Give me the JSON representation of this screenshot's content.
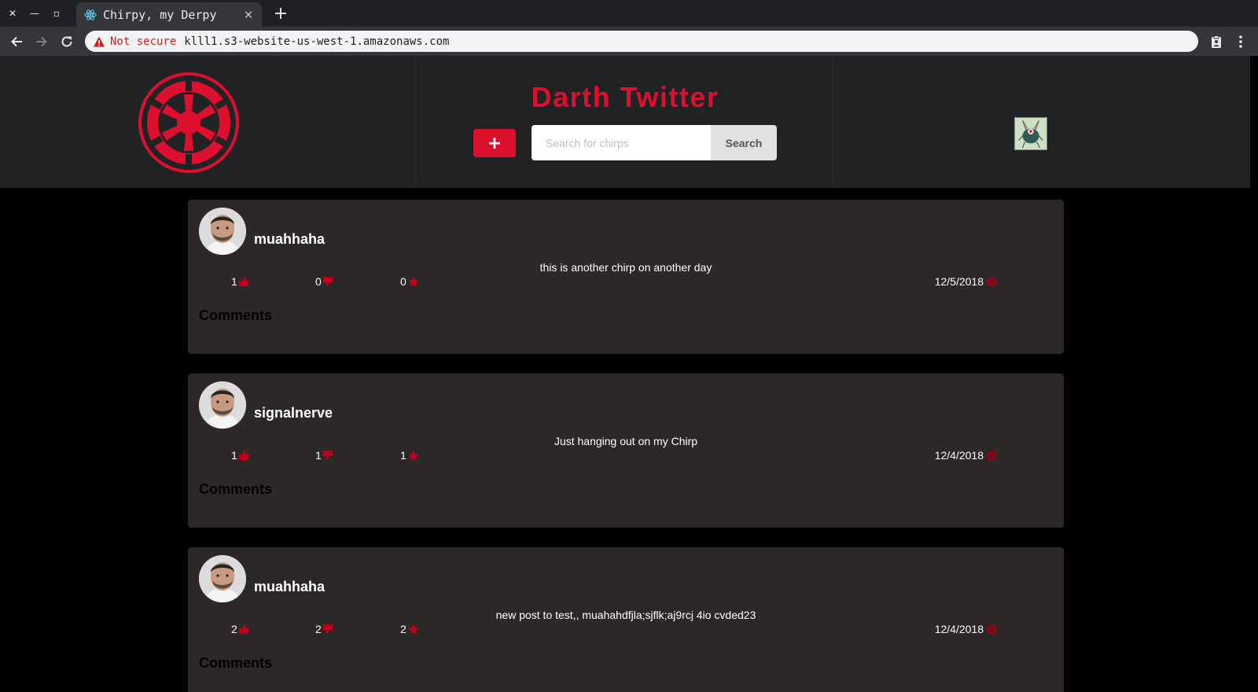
{
  "browser": {
    "tab_title": "Chirpy, my Derpy",
    "security_label": "Not secure",
    "url": "klll1.s3-website-us-west-1.amazonaws.com"
  },
  "header": {
    "title": "Darth Twitter",
    "add_label": "+",
    "search_placeholder": "Search for chirps",
    "search_value": "",
    "search_button": "Search"
  },
  "chirps": [
    {
      "user": "muahhaha",
      "text": "this is another chirp on another day",
      "likes": "1",
      "dislikes": "0",
      "favorites": "0",
      "date": "12/5/2018",
      "comments_title": "Comments"
    },
    {
      "user": "signalnerve",
      "text": "Just hanging out on my Chirp",
      "likes": "1",
      "dislikes": "1",
      "favorites": "1",
      "date": "12/4/2018",
      "comments_title": "Comments"
    },
    {
      "user": "muahhaha",
      "text": "new post to test,, muahahdfjla;sjflk;aj9rcj 4io cvded23",
      "likes": "2",
      "dislikes": "2",
      "favorites": "2",
      "date": "12/4/2018",
      "comments_title": "Comments"
    }
  ],
  "colors": {
    "accent": "#dc0f2f",
    "header_bg": "#212224",
    "card_bg": "#2d2828"
  },
  "icons": [
    "thumbs-up-icon",
    "thumbs-down-icon",
    "star-icon",
    "close-circle-icon",
    "empire-logo-icon"
  ]
}
